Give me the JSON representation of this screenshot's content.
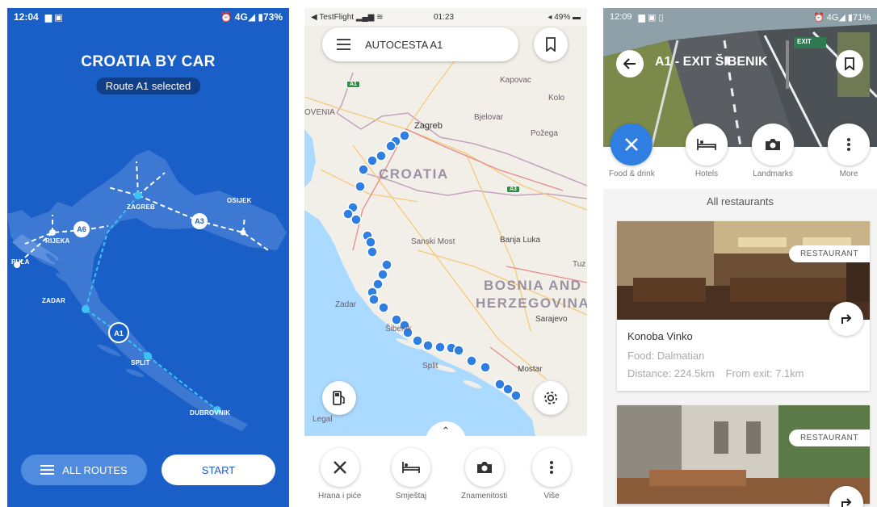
{
  "screen1": {
    "status": {
      "time": "12:04",
      "right": "⏰ 4G◢ ▮73%"
    },
    "title": "CROATIA BY CAR",
    "subtitle": "Route A1 selected",
    "map_labels": {
      "pula": "PULA",
      "rijeka": "RIJEKA",
      "zagreb": "ZAGREB",
      "osijek": "OSIJEK",
      "zadar": "ZADAR",
      "split": "SPLIT",
      "dubrovnik": "DUBROVNIK"
    },
    "route_badges": {
      "a6": "A6",
      "a3": "A3",
      "a1": "A1"
    },
    "buttons": {
      "all_routes": "ALL ROUTES",
      "start": "START"
    },
    "colors": {
      "background": "#1a5fc7",
      "accent": "#3cc2f5"
    }
  },
  "screen2": {
    "status": {
      "left": "◀ TestFlight ▂▄▆ ≋",
      "time": "01:23",
      "right": "◂ 49% ▬"
    },
    "search_placeholder": "AUTOCESTA A1",
    "countries": {
      "croatia": "CROATIA",
      "bosnia": "BOSNIA AND",
      "herzegovina": "HERZEGOVINA"
    },
    "places": {
      "zagreb": "Zagreb",
      "ovenia": "OVENIA",
      "karlovac": "Kapovac",
      "bjelovar": "Bjelovar",
      "sanski": "Sanski Most",
      "banja": "Banja Luka",
      "zadar": "Zadar",
      "split": "Split",
      "mostar": "Mostar",
      "sarajevo": "Sarajevo",
      "tuz": "Tuz",
      "pozega": "Požega",
      "kolo": "Kolo",
      "sibenik": "Šibenik",
      "legal": "Legal"
    },
    "highways": {
      "a1": "A1",
      "a3": "A3"
    },
    "categories": [
      {
        "label": "Hrana i piće"
      },
      {
        "label": "Smještaj"
      },
      {
        "label": "Znamenitosti"
      },
      {
        "label": "Više"
      }
    ],
    "colors": {
      "route_dot": "#2f7fe3",
      "land": "#f2efe9",
      "sea": "#aadaff"
    }
  },
  "screen3": {
    "status": {
      "time": "12:09",
      "right": "⏰ 4G◢ ▮71%"
    },
    "title": "A1 - EXIT ŠIBENIK",
    "exit_sign": "EXIT",
    "categories": [
      {
        "label": "Food & drink",
        "active": true
      },
      {
        "label": "Hotels",
        "active": false
      },
      {
        "label": "Landmarks",
        "active": false
      },
      {
        "label": "More",
        "active": false
      }
    ],
    "section_title": "All restaurants",
    "restaurants": [
      {
        "badge": "RESTAURANT",
        "name": "Konoba Vinko",
        "food": "Food: Dalmatian",
        "distance": "Distance: 224.5km",
        "from_exit": "From exit: 7.1km"
      },
      {
        "badge": "RESTAURANT"
      }
    ],
    "colors": {
      "accent": "#2f7fe3"
    }
  }
}
